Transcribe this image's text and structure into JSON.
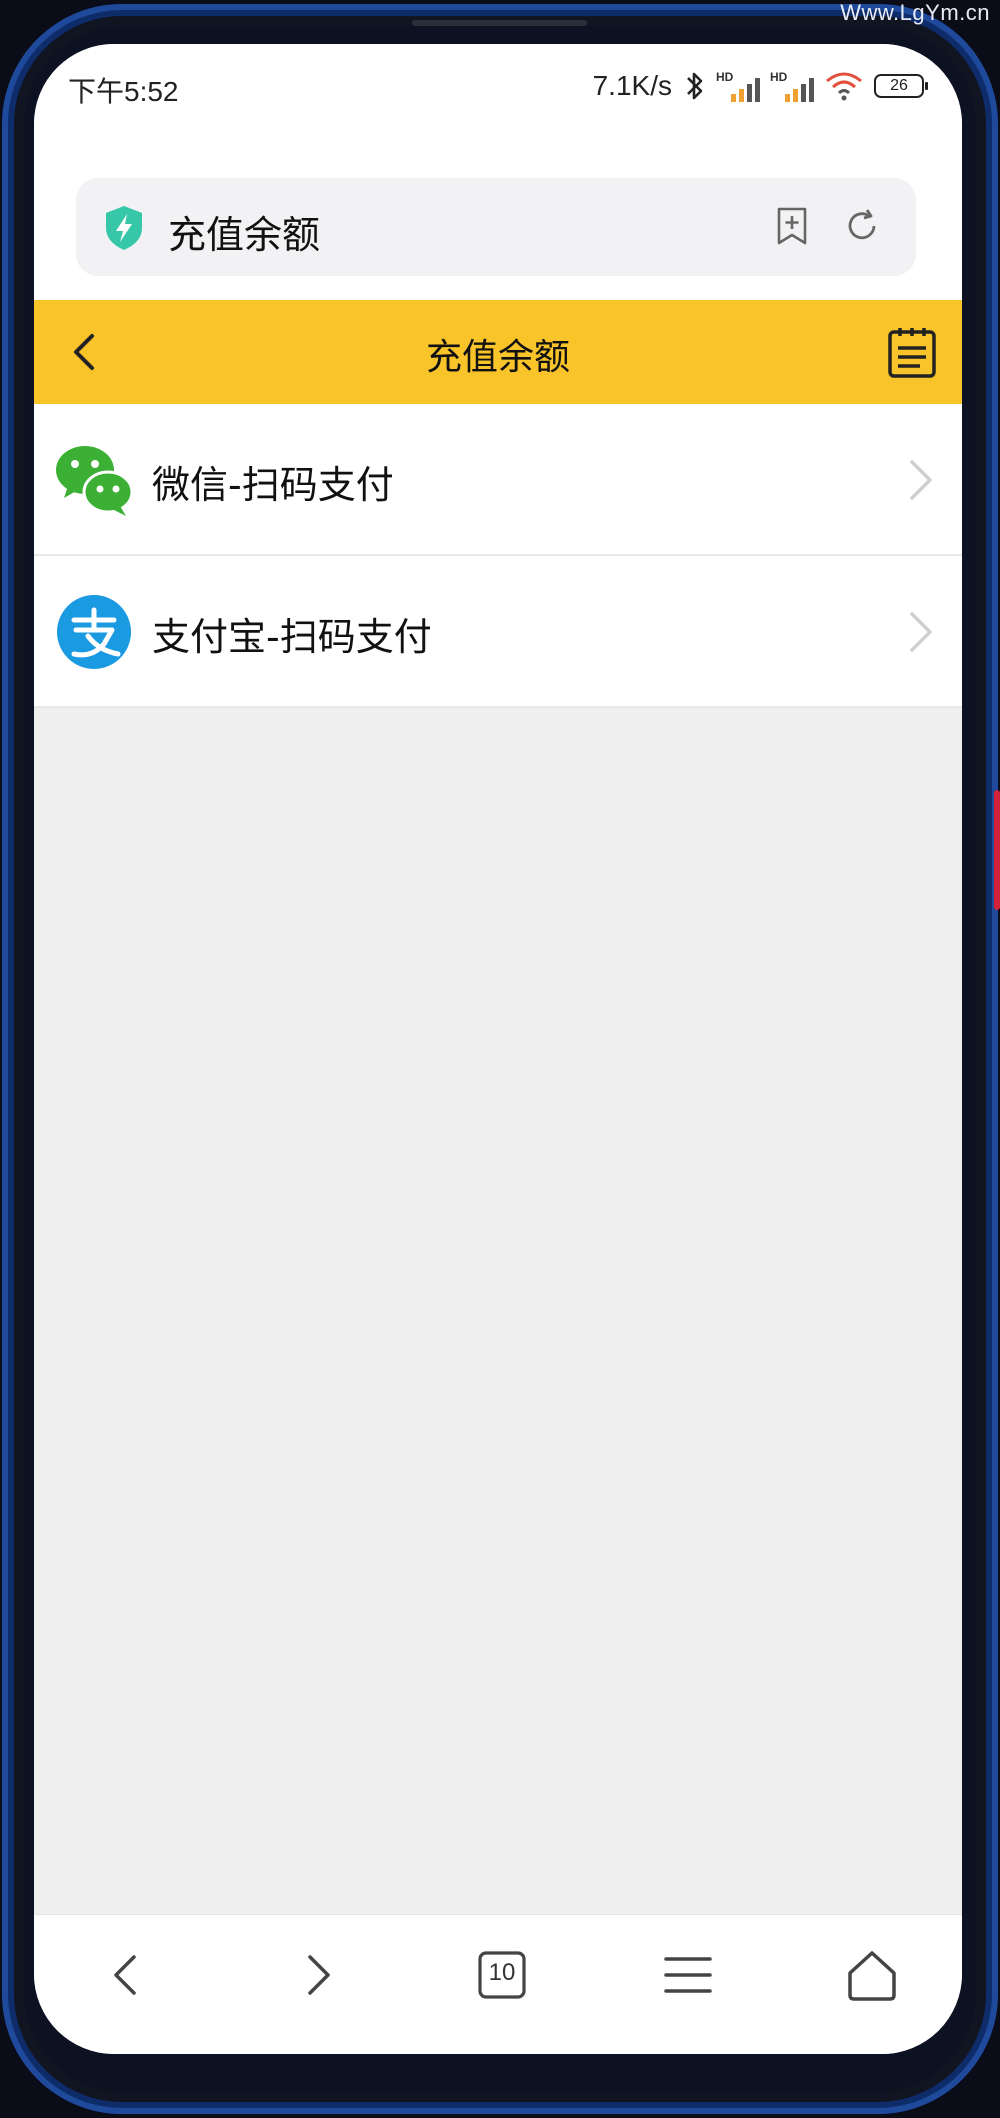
{
  "watermark": "Www.LgYm.cn",
  "status_bar": {
    "time": "下午5:52",
    "net_speed": "7.1K/s",
    "signal_1_label": "HD",
    "signal_2_label": "HD",
    "battery": "26"
  },
  "address_bar": {
    "title": "充值余额"
  },
  "header": {
    "title": "充值余额"
  },
  "payment_options": [
    {
      "label": "微信-扫码支付",
      "icon": "wechat-icon"
    },
    {
      "label": "支付宝-扫码支付",
      "icon": "alipay-icon"
    }
  ],
  "bottom_nav": {
    "tab_count": "10"
  },
  "colors": {
    "header_bg": "#f9c42a",
    "wechat_green": "#3cb034",
    "alipay_blue": "#1a9ae0",
    "page_bg": "#efefef"
  }
}
